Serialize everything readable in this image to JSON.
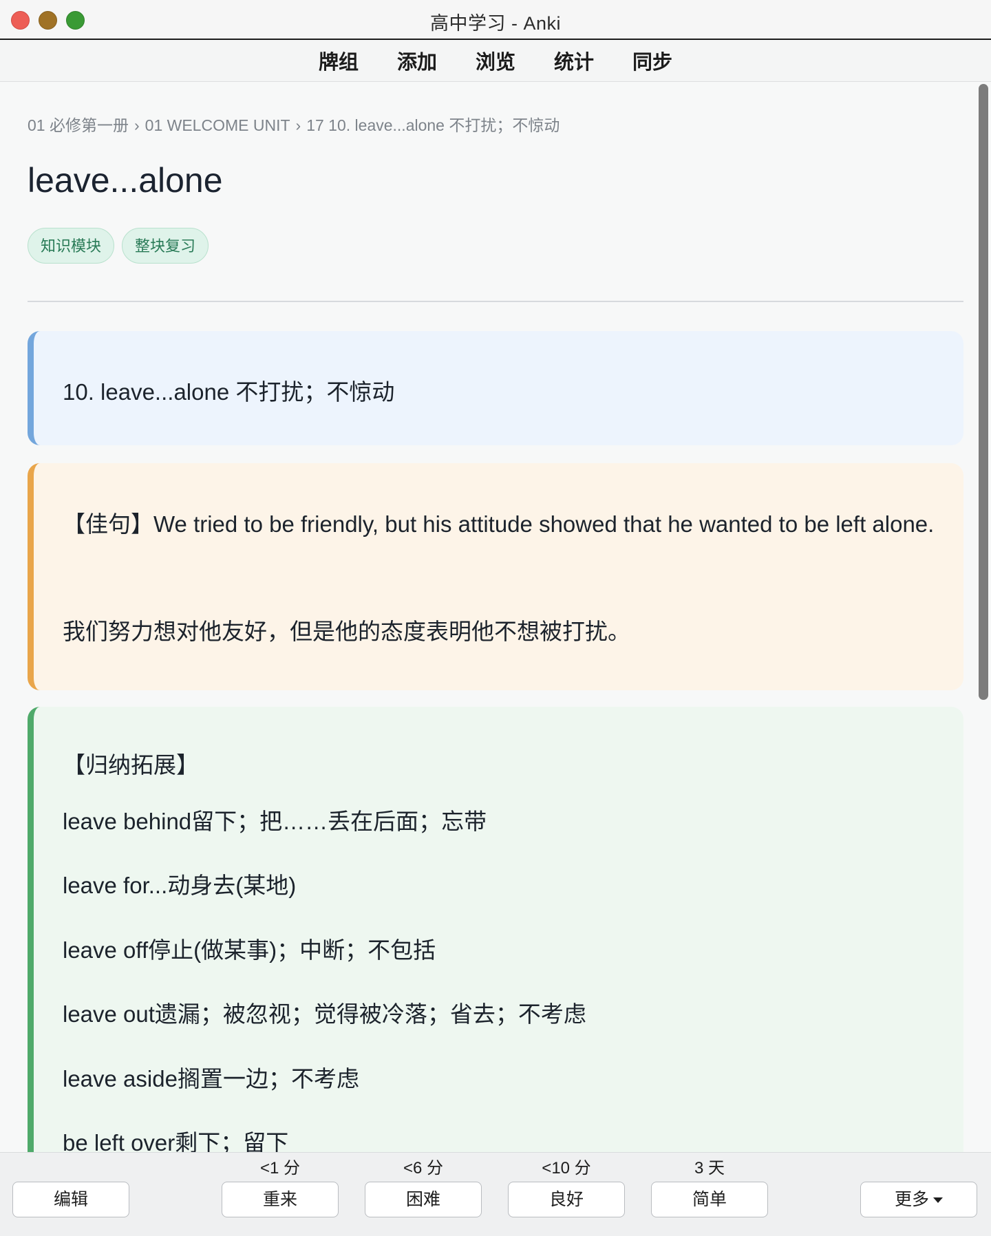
{
  "window": {
    "title": "高中学习 - Anki"
  },
  "toolbar": {
    "items": [
      "牌组",
      "添加",
      "浏览",
      "统计",
      "同步"
    ]
  },
  "breadcrumb": {
    "items": [
      "01 必修第一册",
      "01 WELCOME UNIT",
      "17 10.  leave...alone 不打扰；不惊动"
    ],
    "separator": "›"
  },
  "card": {
    "title": "leave...alone",
    "tags": [
      "知识模块",
      "整块复习"
    ],
    "definition": "10.  leave...alone 不打扰；不惊动",
    "example": {
      "en": "【佳句】We tried to be friendly, but his attitude showed that he wanted to be left alone.",
      "zh": "我们努力想对他友好，但是他的态度表明他不想被打扰。"
    },
    "extension": {
      "heading": "【归纳拓展】",
      "lines": [
        "leave behind留下；把……丢在后面；忘带",
        "leave for...动身去(某地)",
        "leave off停止(做某事)；中断；不包括",
        "leave out遗漏；被忽视；觉得被冷落；省去；不考虑",
        "leave aside搁置一边；不考虑",
        "be left over剩下；留下"
      ]
    }
  },
  "bottom": {
    "edit_label": "编辑",
    "more_label": "更多",
    "answers": [
      {
        "label": "重来",
        "interval": "<1 分"
      },
      {
        "label": "困难",
        "interval": "<6 分"
      },
      {
        "label": "良好",
        "interval": "<10 分"
      },
      {
        "label": "简单",
        "interval": "3 天"
      }
    ]
  },
  "colors": {
    "definition_accent": "#73a6dc",
    "example_accent": "#e9a54a",
    "extension_accent": "#4faa6a",
    "tag_text": "#287a56"
  }
}
